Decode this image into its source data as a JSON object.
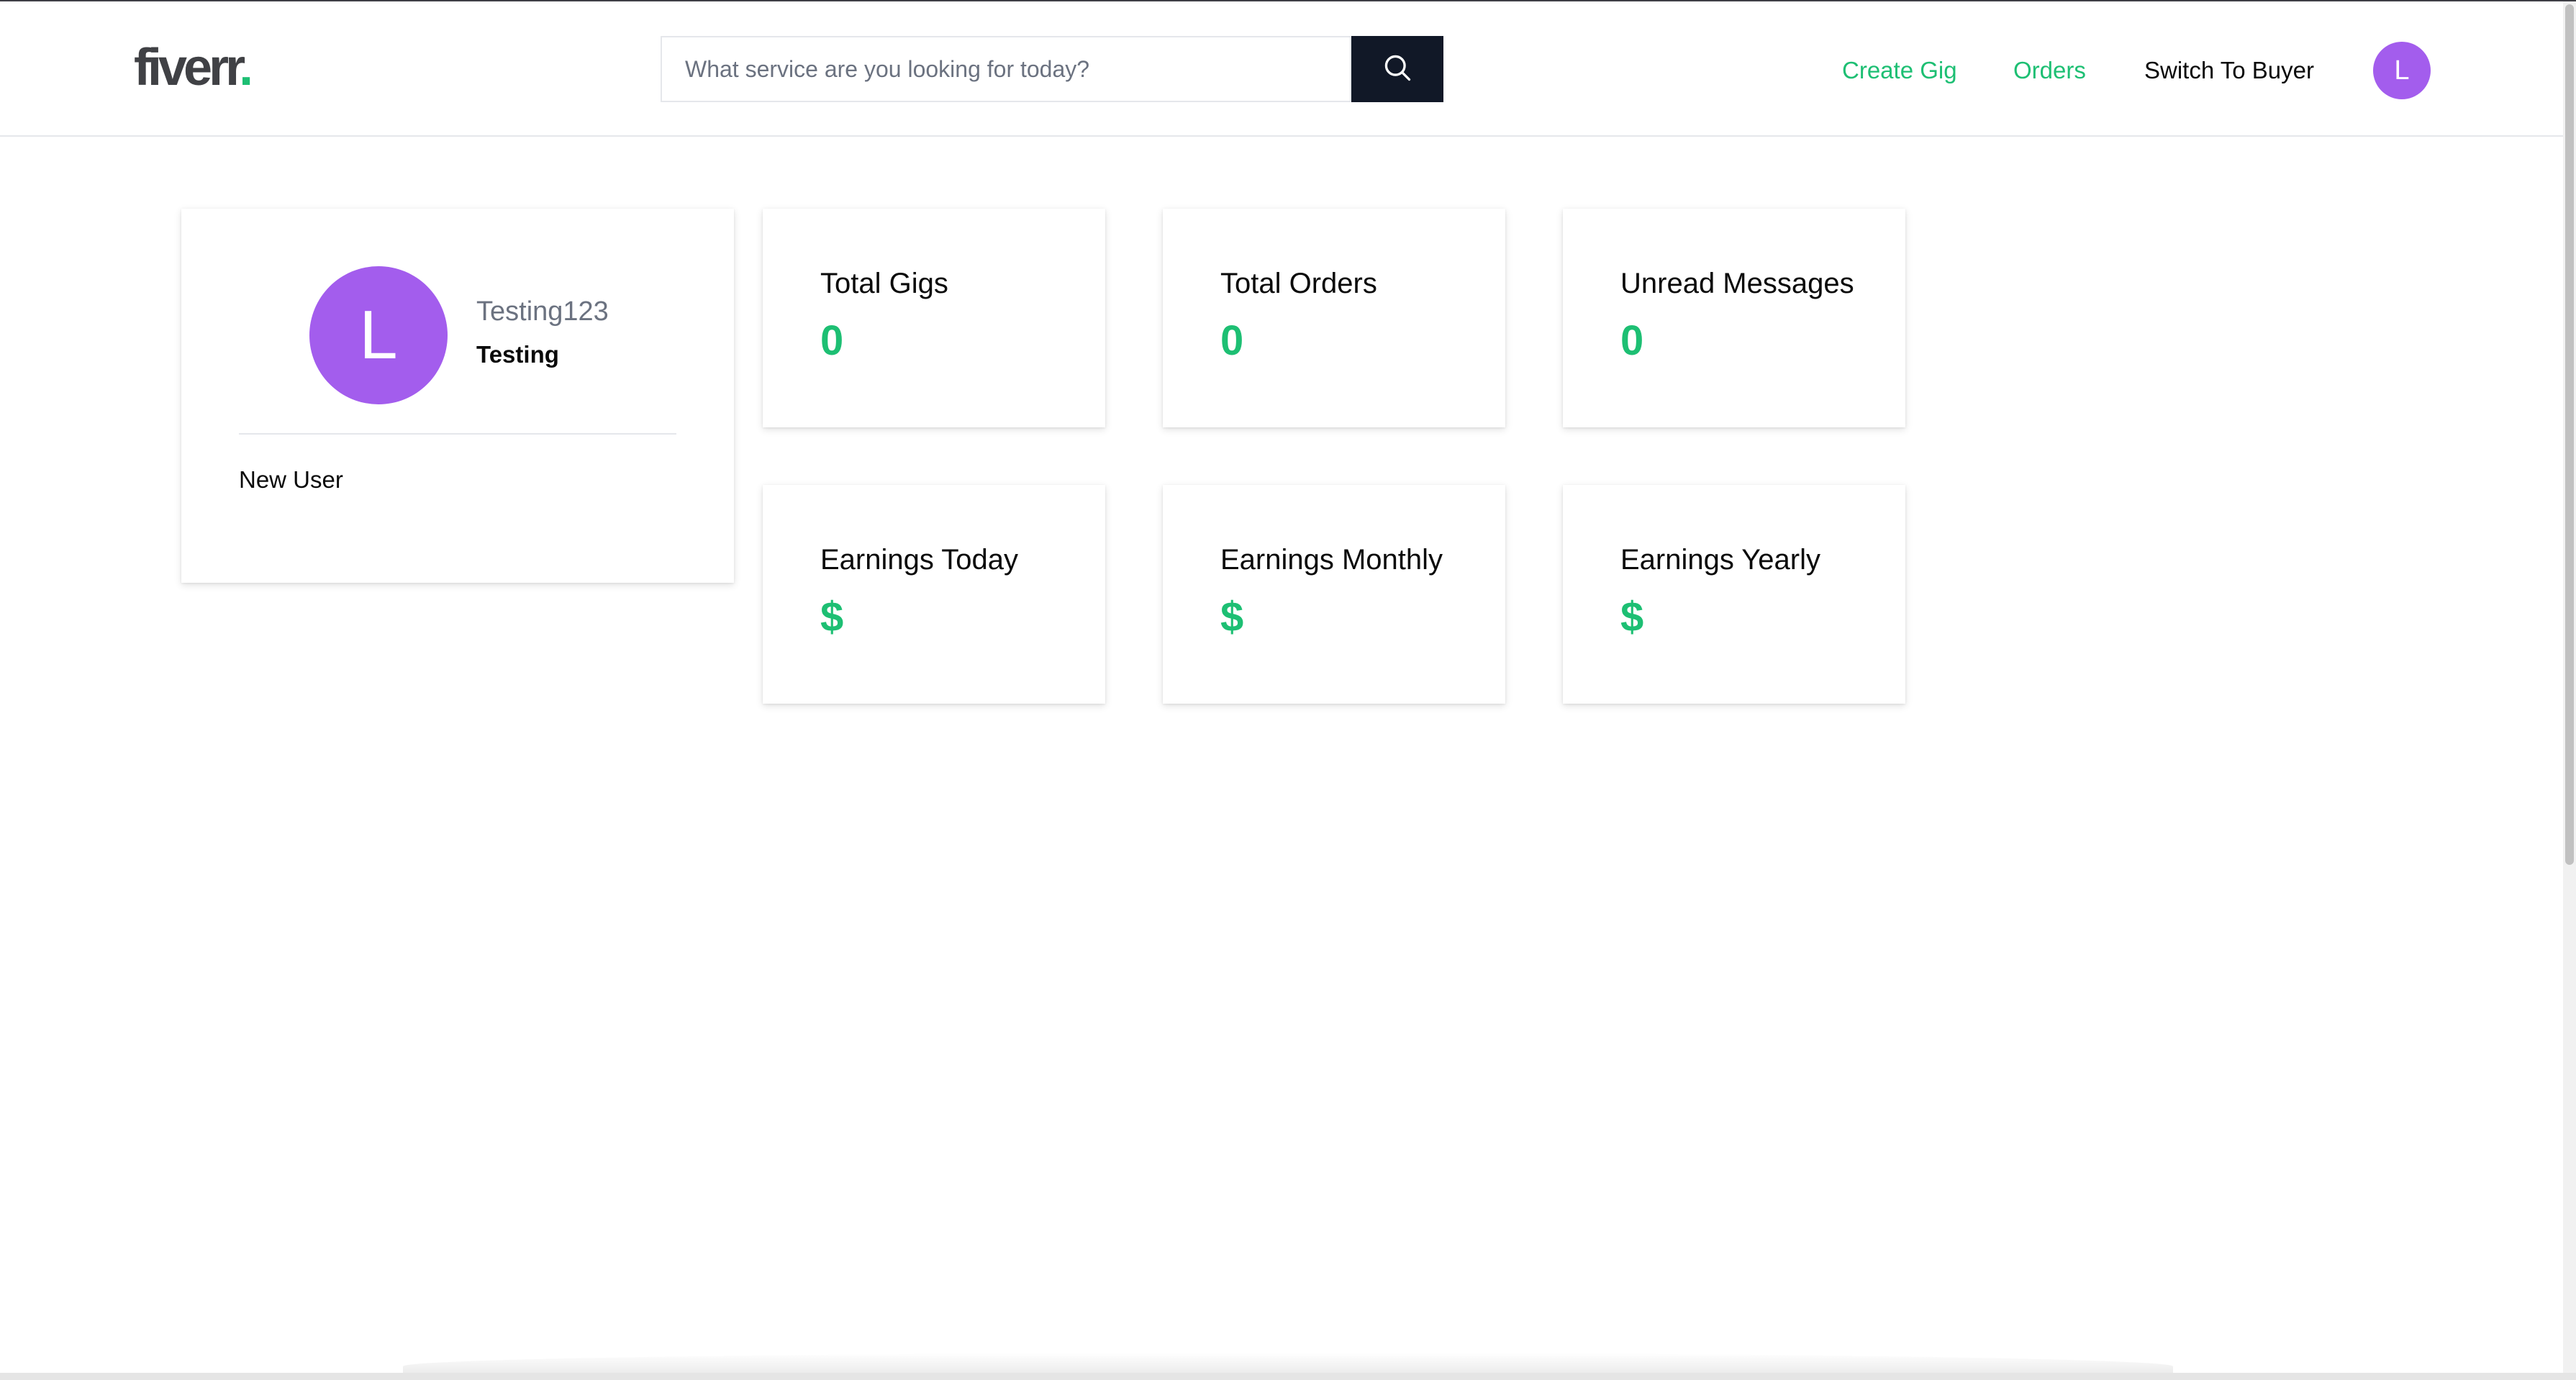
{
  "header": {
    "logo_text": "fiverr",
    "logo_dot": ".",
    "search": {
      "placeholder": "What service are you looking for today?",
      "value": ""
    },
    "nav": {
      "create_gig": "Create Gig",
      "orders": "Orders",
      "switch_mode": "Switch To Buyer",
      "avatar_initial": "L"
    },
    "colors": {
      "brand_green": "#1dbf73",
      "avatar_purple": "#a35ded",
      "search_button": "#111827"
    }
  },
  "profile": {
    "avatar_initial": "L",
    "username": "Testing123",
    "full_name": "Testing",
    "description": "New User"
  },
  "stats": [
    {
      "label": "Total Gigs",
      "value": "0"
    },
    {
      "label": "Total Orders",
      "value": "0"
    },
    {
      "label": "Unread Messages",
      "value": "0"
    },
    {
      "label": "Earnings Today",
      "value": "$"
    },
    {
      "label": "Earnings Monthly",
      "value": "$"
    },
    {
      "label": "Earnings Yearly",
      "value": "$"
    }
  ],
  "icons": {
    "search_button": "search-icon"
  }
}
